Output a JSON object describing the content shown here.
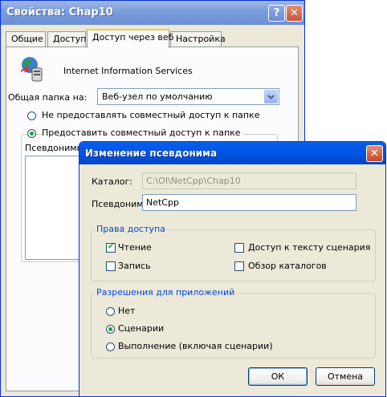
{
  "props_window": {
    "title": "Свойства: Chap10",
    "help_glyph": "?",
    "close_glyph": "✕",
    "tabs": [
      "Общие",
      "Доступ",
      "Доступ через веб",
      "Настройка"
    ],
    "active_tab": "Доступ через веб",
    "service_name": "Internet Information Services",
    "share_on_label": "Общая папка на:",
    "share_on_value": "Веб-узел по умолчанию",
    "radio_no_share": "Не предоставлять совместный доступ к папке",
    "radio_share": "Предоставить совместный доступ к папке",
    "aliases_label": "Псевдонимы"
  },
  "alias_dialog": {
    "title": "Изменение псевдонима",
    "close_glyph": "✕",
    "directory_label": "Каталог:",
    "directory_value": "C:\\OI\\NetCpp\\Chap10",
    "alias_label": "Псевдоним:",
    "alias_value": "NetCpp",
    "access_group": {
      "title": "Права доступа",
      "read": {
        "label": "Чтение",
        "checked": true
      },
      "write": {
        "label": "Запись",
        "checked": false
      },
      "script_source": {
        "label": "Доступ к тексту сценария",
        "checked": false
      },
      "directory_browsing": {
        "label": "Обзор каталогов",
        "checked": false
      }
    },
    "app_group": {
      "title": "Разрешения для приложений",
      "options": [
        "Нет",
        "Сценарии",
        "Выполнение (включая сценарии)"
      ],
      "selected": "Сценарии"
    },
    "ok_label": "ОК",
    "cancel_label": "Отмена"
  }
}
